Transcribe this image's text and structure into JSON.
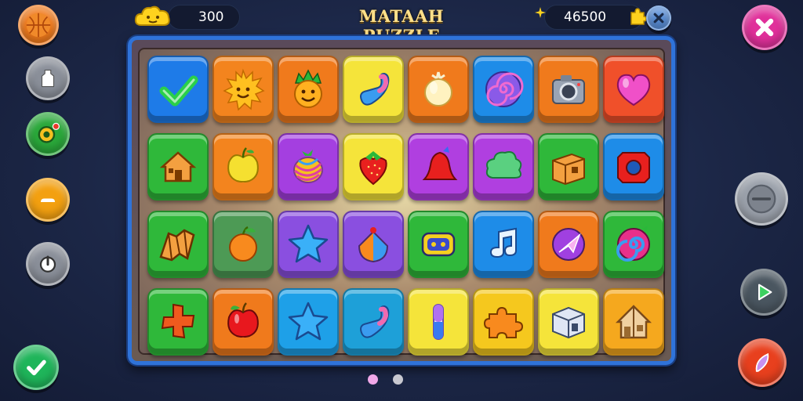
{
  "header": {
    "title": "MATAAH PUZZLE",
    "score": "300",
    "best": "46500"
  },
  "left_buttons": [
    {
      "name": "basketball-icon",
      "color": "#f07a1c"
    },
    {
      "name": "bottle-icon",
      "color": "#8a8f99"
    },
    {
      "name": "coin-icon",
      "color": "#2aa83a"
    },
    {
      "name": "minus-icon",
      "color": "#f3a010"
    },
    {
      "name": "power-icon",
      "color": "#8a8f99"
    },
    {
      "name": "checkmark-icon",
      "color": "#1fb55a"
    }
  ],
  "right_buttons": [
    {
      "name": "close-icon",
      "color": "#e0309a"
    },
    {
      "name": "joystick-icon",
      "color": "#9aa0aa"
    },
    {
      "name": "play-icon",
      "color": "#4a5660"
    },
    {
      "name": "feather-icon",
      "color": "#e8401e"
    }
  ],
  "board": {
    "rows": [
      [
        {
          "bg": "#1e7be8",
          "icon": "checkmark-icon"
        },
        {
          "bg": "#f3841e",
          "icon": "sun-icon"
        },
        {
          "bg": "#f07a1c",
          "icon": "smiley-plant-icon"
        },
        {
          "bg": "#f5e43a",
          "icon": "candy-cane-icon"
        },
        {
          "bg": "#f07a1c",
          "icon": "onion-icon"
        },
        {
          "bg": "#1e8ce8",
          "icon": "spiral-icon"
        },
        {
          "bg": "#f07a1c",
          "icon": "camera-icon"
        },
        {
          "bg": "#f0502a",
          "icon": "heart-icon"
        }
      ],
      [
        {
          "bg": "#2fb83a",
          "icon": "house-icon"
        },
        {
          "bg": "#f3841e",
          "icon": "apple-icon"
        },
        {
          "bg": "#a43fe0",
          "icon": "striped-fruit-icon"
        },
        {
          "bg": "#f5e43a",
          "icon": "strawberry-icon"
        },
        {
          "bg": "#b03fe0",
          "icon": "bell-icon"
        },
        {
          "bg": "#b03fe0",
          "icon": "bush-icon"
        },
        {
          "bg": "#2fb83a",
          "icon": "box-icon"
        },
        {
          "bg": "#1e8ce8",
          "icon": "ring-icon"
        }
      ],
      [
        {
          "bg": "#2fb83a",
          "icon": "map-icon"
        },
        {
          "bg": "#4d9a55",
          "icon": "orange-icon"
        },
        {
          "bg": "#8a4fe0",
          "icon": "star-icon"
        },
        {
          "bg": "#8a4fe0",
          "icon": "ball-icon"
        },
        {
          "bg": "#2fb83a",
          "icon": "tape-icon"
        },
        {
          "bg": "#1e8ce8",
          "icon": "music-note-icon"
        },
        {
          "bg": "#f07a1c",
          "icon": "arrow-badge-icon"
        },
        {
          "bg": "#2fb83a",
          "icon": "swirl-icon"
        }
      ],
      [
        {
          "bg": "#2fb83a",
          "icon": "cross-icon"
        },
        {
          "bg": "#f07a1c",
          "icon": "red-apple-icon"
        },
        {
          "bg": "#1ea0e8",
          "icon": "star-icon"
        },
        {
          "bg": "#1ea0d8",
          "icon": "candy-cane-icon"
        },
        {
          "bg": "#f5e43a",
          "icon": "capsule-icon"
        },
        {
          "bg": "#f5c81e",
          "icon": "puzzle-icon"
        },
        {
          "bg": "#f5e43a",
          "icon": "cube-icon"
        },
        {
          "bg": "#f5a81e",
          "icon": "hut-icon"
        }
      ]
    ]
  },
  "page_dots": [
    {
      "color": "#f0a8e8"
    },
    {
      "color": "#c8c8d0"
    }
  ]
}
